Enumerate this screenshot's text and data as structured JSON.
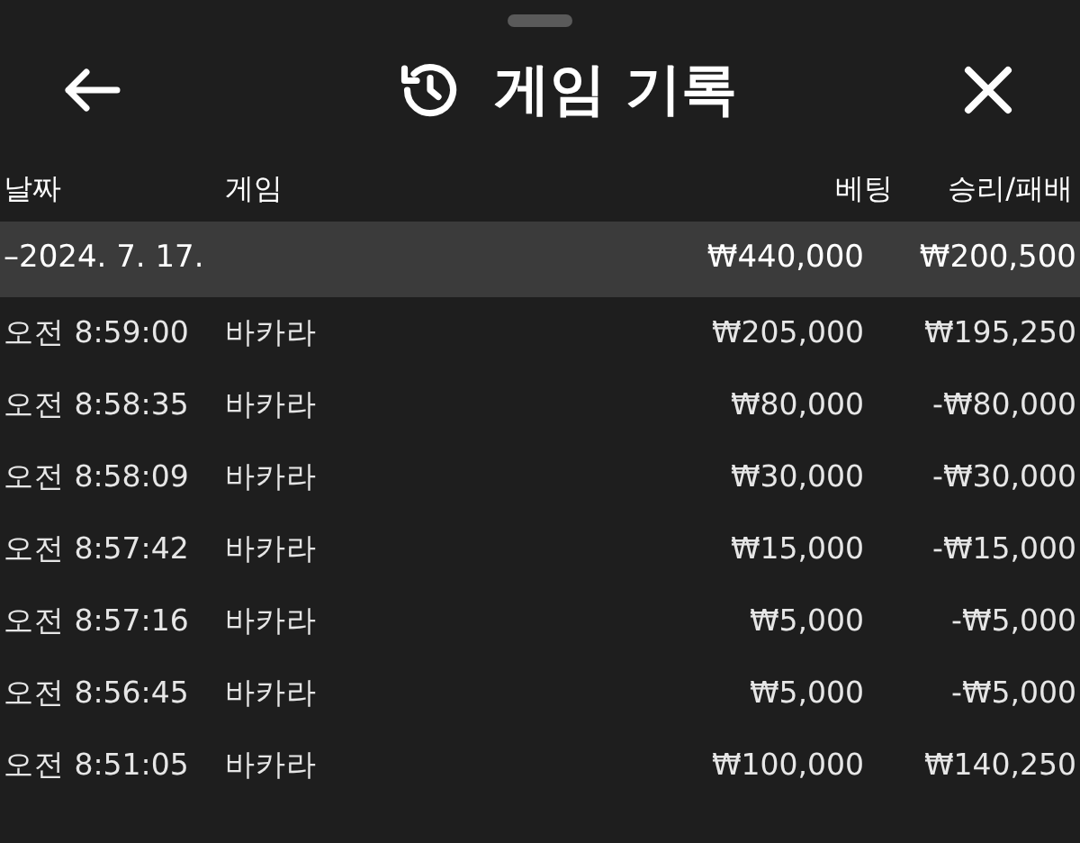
{
  "header": {
    "title": "게임 기록"
  },
  "table": {
    "columns": [
      "날짜",
      "게임",
      "베팅",
      "승리/패배"
    ],
    "group": {
      "date": "–2024. 7. 17.",
      "bet": "₩440,000",
      "result": "₩200,500",
      "expanded": true
    },
    "rows": [
      {
        "time": "오전 8:59:00",
        "game": "바카라",
        "bet": "₩205,000",
        "result": "₩195,250"
      },
      {
        "time": "오전 8:58:35",
        "game": "바카라",
        "bet": "₩80,000",
        "result": "-₩80,000"
      },
      {
        "time": "오전 8:58:09",
        "game": "바카라",
        "bet": "₩30,000",
        "result": "-₩30,000"
      },
      {
        "time": "오전 8:57:42",
        "game": "바카라",
        "bet": "₩15,000",
        "result": "-₩15,000"
      },
      {
        "time": "오전 8:57:16",
        "game": "바카라",
        "bet": "₩5,000",
        "result": "-₩5,000"
      },
      {
        "time": "오전 8:56:45",
        "game": "바카라",
        "bet": "₩5,000",
        "result": "-₩5,000"
      },
      {
        "time": "오전 8:51:05",
        "game": "바카라",
        "bet": "₩100,000",
        "result": "₩140,250"
      }
    ]
  }
}
